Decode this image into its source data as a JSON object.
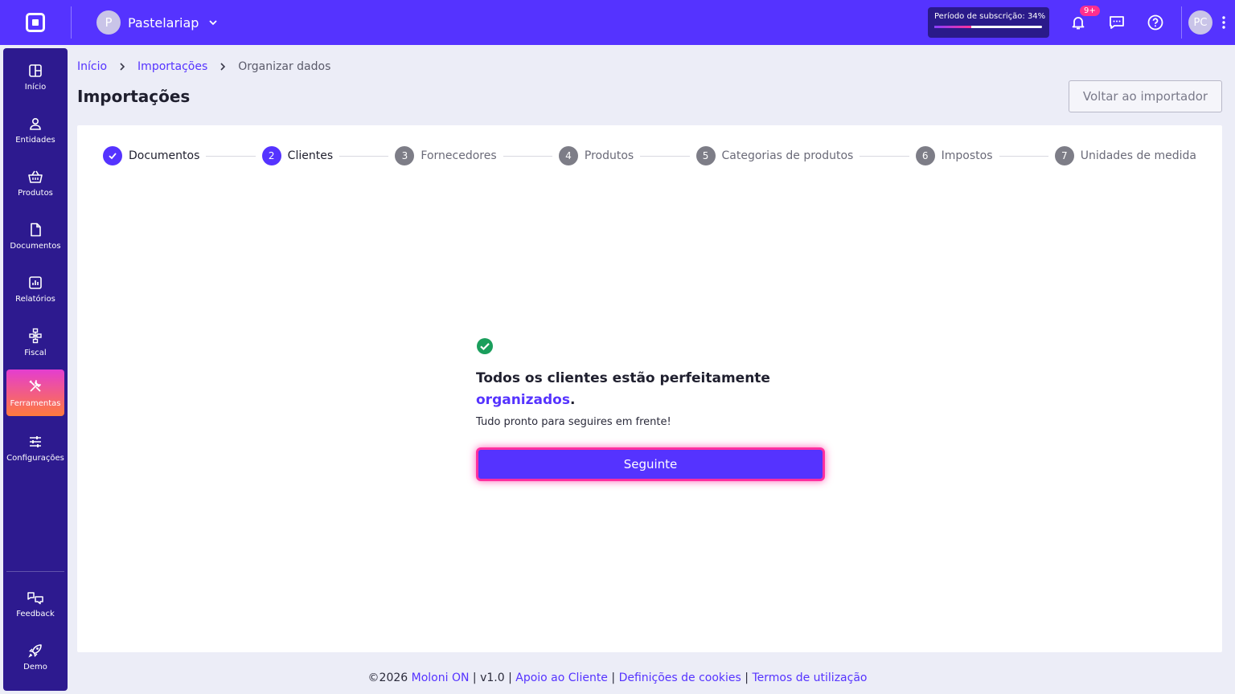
{
  "topbar": {
    "company_initial": "P",
    "company_name": "Pastelariap",
    "subscription_label": "Período de subscrição: 34%",
    "subscription_progress": 0.34,
    "notifications_badge": "9+",
    "user_initials": "PC"
  },
  "sidebar": {
    "items": [
      {
        "label": "Início",
        "icon": "home-grid-icon"
      },
      {
        "label": "Entidades",
        "icon": "person-icon"
      },
      {
        "label": "Produtos",
        "icon": "basket-icon"
      },
      {
        "label": "Documentos",
        "icon": "document-icon"
      },
      {
        "label": "Relatórios",
        "icon": "report-icon"
      },
      {
        "label": "Fiscal",
        "icon": "fiscal-icon"
      },
      {
        "label": "Ferramentas",
        "icon": "tools-icon"
      },
      {
        "label": "Configurações",
        "icon": "sliders-icon"
      }
    ],
    "bottom_items": [
      {
        "label": "Feedback",
        "icon": "feedback-icon"
      },
      {
        "label": "Demo",
        "icon": "rocket-icon"
      }
    ],
    "active": "Ferramentas"
  },
  "breadcrumb": {
    "home": "Início",
    "imports": "Importações",
    "current": "Organizar dados"
  },
  "page": {
    "title": "Importações",
    "back_button": "Voltar ao importador"
  },
  "steps": [
    {
      "number": "1",
      "label": "Documentos",
      "state": "done"
    },
    {
      "number": "2",
      "label": "Clientes",
      "state": "current"
    },
    {
      "number": "3",
      "label": "Fornecedores",
      "state": "pending"
    },
    {
      "number": "4",
      "label": "Produtos",
      "state": "pending"
    },
    {
      "number": "5",
      "label": "Categorias de produtos",
      "state": "pending"
    },
    {
      "number": "6",
      "label": "Impostos",
      "state": "pending"
    },
    {
      "number": "7",
      "label": "Unidades de medida",
      "state": "pending"
    }
  ],
  "message": {
    "title_part1": "Todos os clientes estão perfeitamente",
    "title_highlight": "organizados",
    "title_end": ".",
    "subtitle": "Tudo pronto para seguires em frente!",
    "next_button": "Seguinte"
  },
  "footer": {
    "copyright": "©2026 ",
    "brand": "Moloni ON",
    "version": "v1.0",
    "separator": " | ",
    "support": "Apoio ao Cliente",
    "cookies": "Definições de cookies",
    "terms": "Termos de utilização"
  },
  "colors": {
    "primary": "#5533ff",
    "sidebar": "#2d1a8f",
    "success": "#1a9e5c",
    "accent_pink": "#ff2fa0"
  }
}
